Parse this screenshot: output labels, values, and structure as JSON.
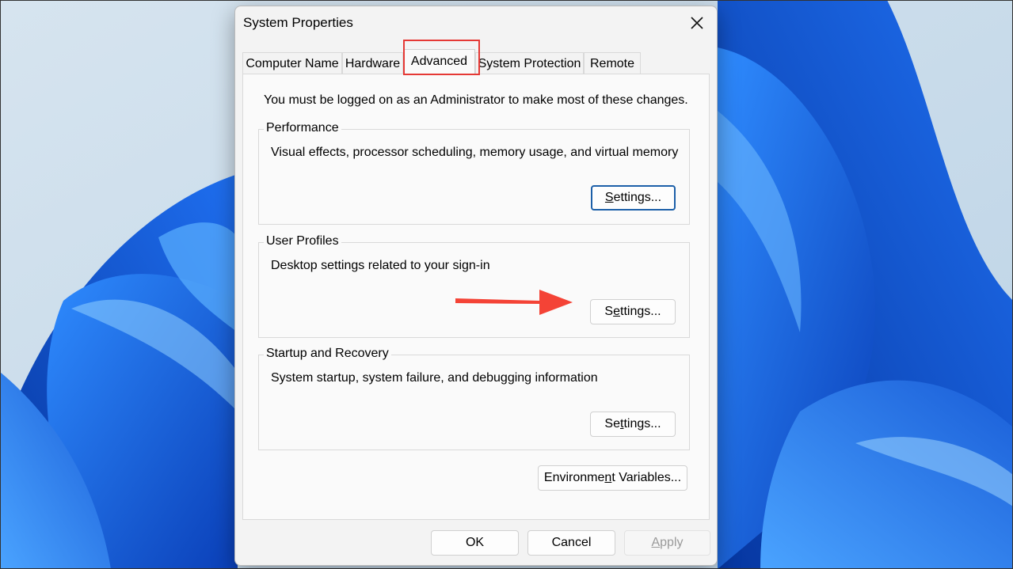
{
  "window": {
    "title": "System Properties",
    "close_icon": "close-icon"
  },
  "tabs": [
    {
      "label": "Computer Name",
      "active": false
    },
    {
      "label": "Hardware",
      "active": false
    },
    {
      "label": "Advanced",
      "active": true
    },
    {
      "label": "System Protection",
      "active": false
    },
    {
      "label": "Remote",
      "active": false
    }
  ],
  "advanced": {
    "admin_note": "You must be logged on as an Administrator to make most of these changes.",
    "performance": {
      "title": "Performance",
      "description": "Visual effects, processor scheduling, memory usage, and virtual memory",
      "button": {
        "pre": "",
        "key": "S",
        "post": "ettings..."
      }
    },
    "user_profiles": {
      "title": "User Profiles",
      "description": "Desktop settings related to your sign-in",
      "button": {
        "pre": "S",
        "key": "e",
        "post": "ttings..."
      }
    },
    "startup_recovery": {
      "title": "Startup and Recovery",
      "description": "System startup, system failure, and debugging information",
      "button": {
        "pre": "Se",
        "key": "t",
        "post": "tings..."
      }
    },
    "env_button": {
      "pre": "Environme",
      "key": "n",
      "post": "t Variables..."
    }
  },
  "footer": {
    "ok": "OK",
    "cancel": "Cancel",
    "apply": {
      "pre": "",
      "key": "A",
      "post": "pply"
    }
  },
  "annotations": {
    "highlight_color": "#e53935",
    "arrow_color": "#f44336"
  }
}
